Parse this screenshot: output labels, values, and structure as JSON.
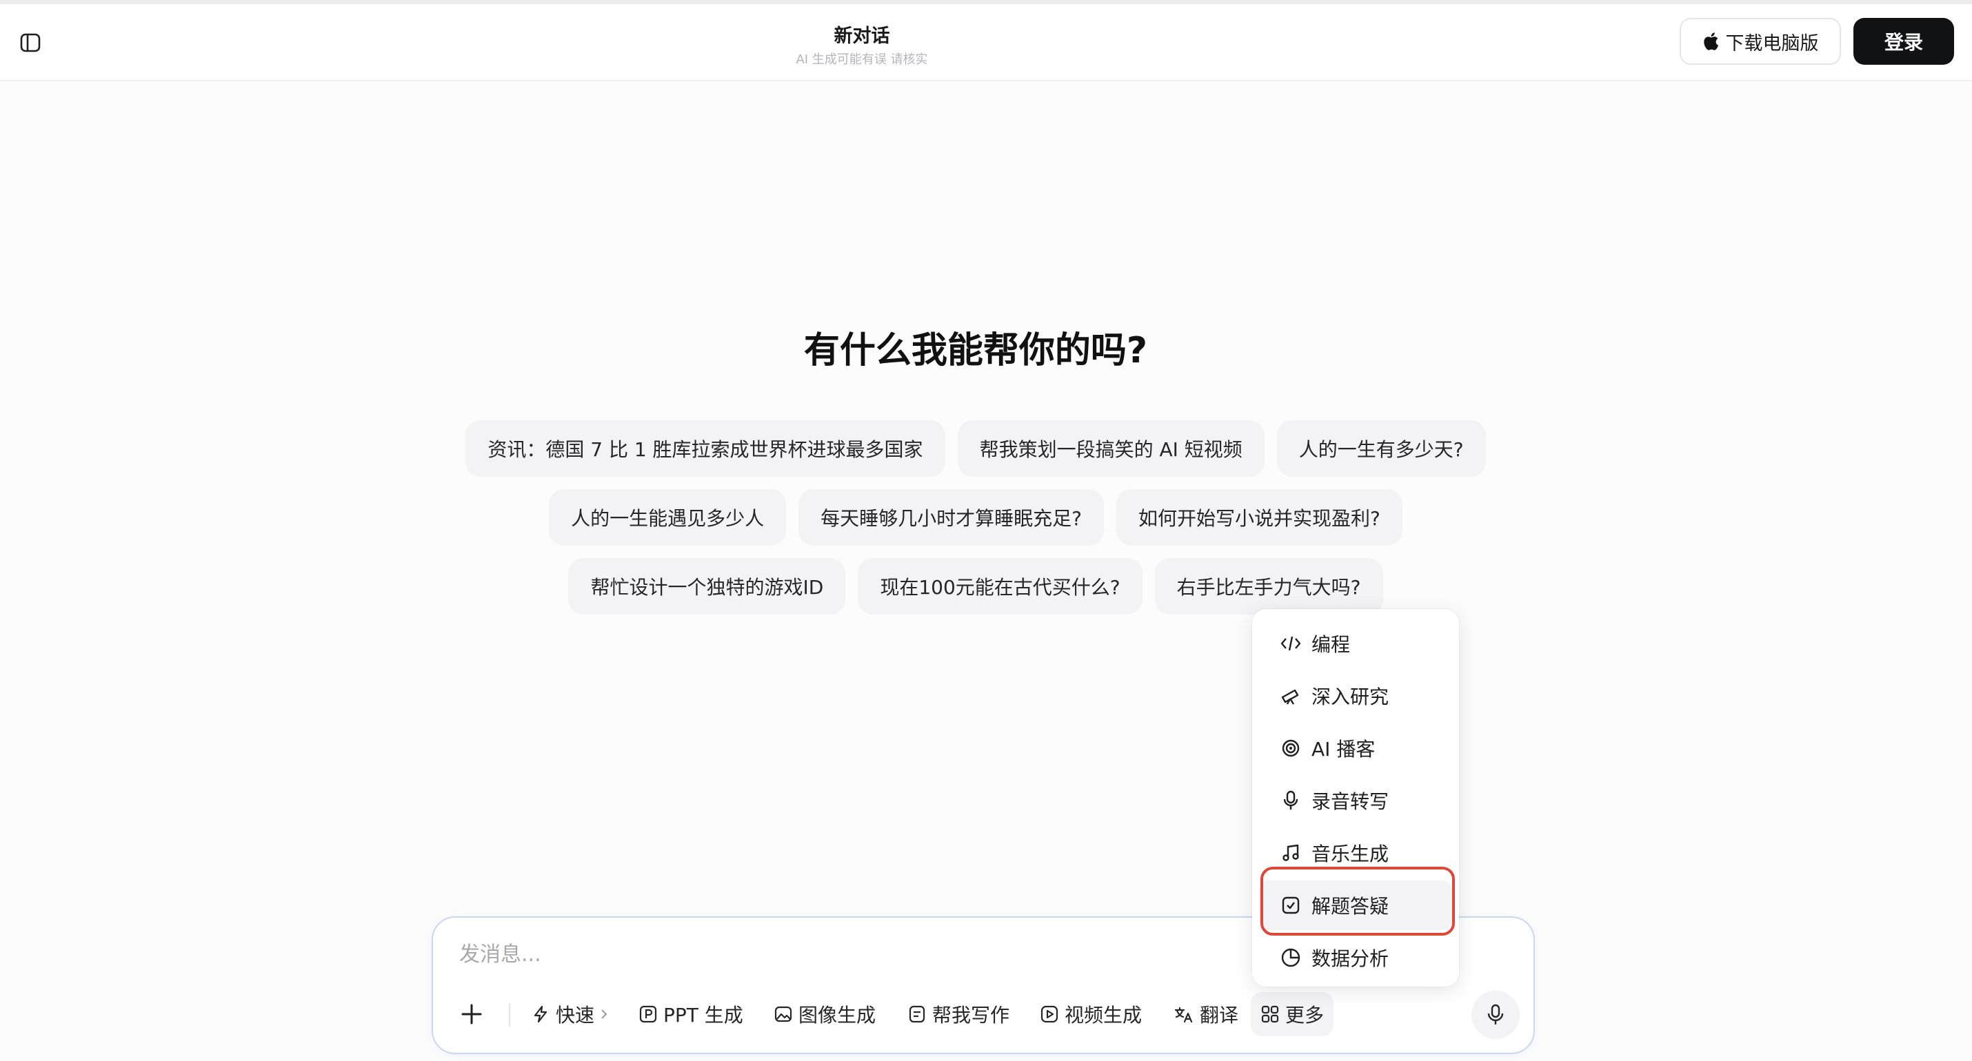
{
  "header": {
    "title": "新对话",
    "subtitle": "AI 生成可能有误 请核实",
    "download_label": "下载电脑版",
    "login_label": "登录"
  },
  "main": {
    "greeting": "有什么我能帮你的吗?",
    "suggestions": [
      [
        "资讯：德国 7 比 1 胜库拉索成世界杯进球最多国家",
        "帮我策划一段搞笑的 AI 短视频",
        "人的一生有多少天?"
      ],
      [
        "人的一生能遇见多少人",
        "每天睡够几小时才算睡眠充足?",
        "如何开始写小说并实现盈利?"
      ],
      [
        "帮忙设计一个独特的游戏ID",
        "现在100元能在古代买什么?",
        "右手比左手力气大吗?"
      ]
    ]
  },
  "more_menu": {
    "items": [
      {
        "label": "编程",
        "icon": "code-icon"
      },
      {
        "label": "深入研究",
        "icon": "telescope-icon"
      },
      {
        "label": "AI 播客",
        "icon": "podcast-icon"
      },
      {
        "label": "录音转写",
        "icon": "microphone-icon"
      },
      {
        "label": "音乐生成",
        "icon": "music-note-icon"
      },
      {
        "label": "解题答疑",
        "icon": "problem-solve-icon",
        "highlighted": true
      },
      {
        "label": "数据分析",
        "icon": "pie-chart-icon"
      }
    ]
  },
  "composer": {
    "placeholder": "发消息...",
    "tools": {
      "fast": "快速",
      "ppt": "PPT 生成",
      "image": "图像生成",
      "write": "帮我写作",
      "video": "视频生成",
      "translate": "翻译",
      "more": "更多"
    }
  },
  "colors": {
    "login_bg": "#111214",
    "composer_border": "#c9d7f2",
    "highlight_ring": "#e1463b",
    "chip_bg": "#f3f3f5"
  }
}
